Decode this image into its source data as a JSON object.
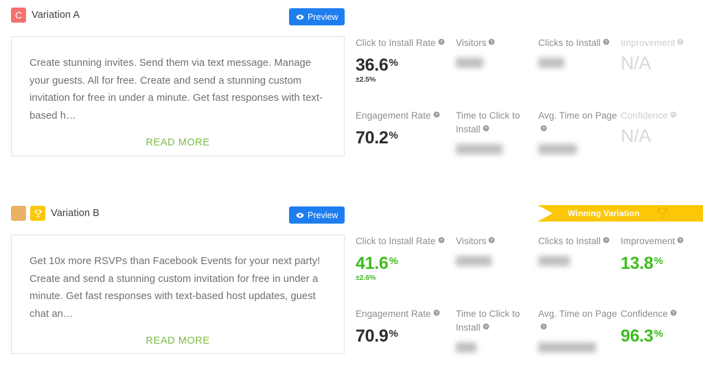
{
  "variations": [
    {
      "key": "a",
      "badges": [
        {
          "name": "letter-badge",
          "letter": "C",
          "color": "#f4716f",
          "icon": ""
        }
      ],
      "title": "Variation A",
      "preview_label": "Preview",
      "winning": false,
      "winning_label": "",
      "body_text": "Create stunning invites. Send them via text message. Manage your guests. All for free. Create and send a stunning custom invitation for free in under a minute. Get fast responses with text-based h…",
      "read_more_label": "READ MORE",
      "metric_rows": [
        [
          {
            "label": "Click to Install Rate",
            "help": true,
            "muted": false,
            "value": "36.6",
            "unit": "%",
            "delta": "±2.5%",
            "green": false,
            "blurred": false
          },
          {
            "label": "Visitors",
            "help": true,
            "muted": false,
            "value": "",
            "unit": "",
            "delta": "",
            "green": false,
            "blurred": true,
            "blur_width": "w1"
          },
          {
            "label": "Clicks to Install",
            "help": true,
            "muted": false,
            "value": "",
            "unit": "",
            "delta": "",
            "green": false,
            "blurred": true,
            "blur_width": "w2"
          },
          {
            "label": "Improvement",
            "help": true,
            "muted": true,
            "value": "N/A",
            "unit": "",
            "delta": "",
            "green": false,
            "blurred": false,
            "na": true
          }
        ],
        [
          {
            "label": "Engagement Rate",
            "help": true,
            "muted": false,
            "value": "70.2",
            "unit": "%",
            "delta": "",
            "green": false,
            "blurred": false
          },
          {
            "label": "Time to Click to Install",
            "help": true,
            "muted": false,
            "value": "",
            "unit": "",
            "delta": "",
            "green": false,
            "blurred": true,
            "blur_width": "w3"
          },
          {
            "label": "Avg. Time on Page",
            "help": true,
            "muted": false,
            "value": "",
            "unit": "",
            "delta": "",
            "green": false,
            "blurred": true,
            "blur_width": "w4"
          },
          {
            "label": "Confidence",
            "help": true,
            "muted": true,
            "value": "N/A",
            "unit": "",
            "delta": "",
            "green": false,
            "blurred": false,
            "na": true
          }
        ]
      ]
    },
    {
      "key": "b",
      "badges": [
        {
          "name": "color-badge",
          "letter": "",
          "color": "#eab264",
          "icon": ""
        },
        {
          "name": "trophy-badge",
          "letter": "",
          "color": "#fbc707",
          "icon": "trophy-icon"
        }
      ],
      "title": "Variation B",
      "preview_label": "Preview",
      "winning": true,
      "winning_label": "Winning Variation",
      "body_text": "Get 10x more RSVPs than Facebook Events for your next party! Create and send a stunning custom invitation for free in under a minute. Get fast responses with text-based host updates, guest chat an…",
      "read_more_label": "READ MORE",
      "metric_rows": [
        [
          {
            "label": "Click to Install Rate",
            "help": true,
            "muted": false,
            "value": "41.6",
            "unit": "%",
            "delta": "±2.6%",
            "green": true,
            "blurred": false
          },
          {
            "label": "Visitors",
            "help": true,
            "muted": false,
            "value": "",
            "unit": "",
            "delta": "",
            "green": false,
            "blurred": true,
            "blur_width": "w5"
          },
          {
            "label": "Clicks to Install",
            "help": true,
            "muted": false,
            "value": "",
            "unit": "",
            "delta": "",
            "green": false,
            "blurred": true,
            "blur_width": "w6"
          },
          {
            "label": "Improvement",
            "help": true,
            "muted": false,
            "value": "13.8",
            "unit": "%",
            "delta": "",
            "green": true,
            "blurred": false
          }
        ],
        [
          {
            "label": "Engagement Rate",
            "help": true,
            "muted": false,
            "value": "70.9",
            "unit": "%",
            "delta": "",
            "green": false,
            "blurred": false
          },
          {
            "label": "Time to Click to Install",
            "help": true,
            "muted": false,
            "value": "",
            "unit": "",
            "delta": "",
            "green": false,
            "blurred": true,
            "blur_width": "w7"
          },
          {
            "label": "Avg. Time on Page",
            "help": true,
            "muted": false,
            "value": "",
            "unit": "",
            "delta": "",
            "green": false,
            "blurred": true,
            "blur_width": "w8"
          },
          {
            "label": "Confidence",
            "help": true,
            "muted": false,
            "value": "96.3",
            "unit": "%",
            "delta": "",
            "green": true,
            "blurred": false
          }
        ]
      ]
    }
  ],
  "colors": {
    "accent_blue": "#1e7ef0",
    "positive_green": "#3dbd1c",
    "read_more_green": "#7cbb42",
    "winning_yellow": "#fbc707",
    "badge_red": "#f4716f",
    "badge_tan": "#eab264"
  }
}
